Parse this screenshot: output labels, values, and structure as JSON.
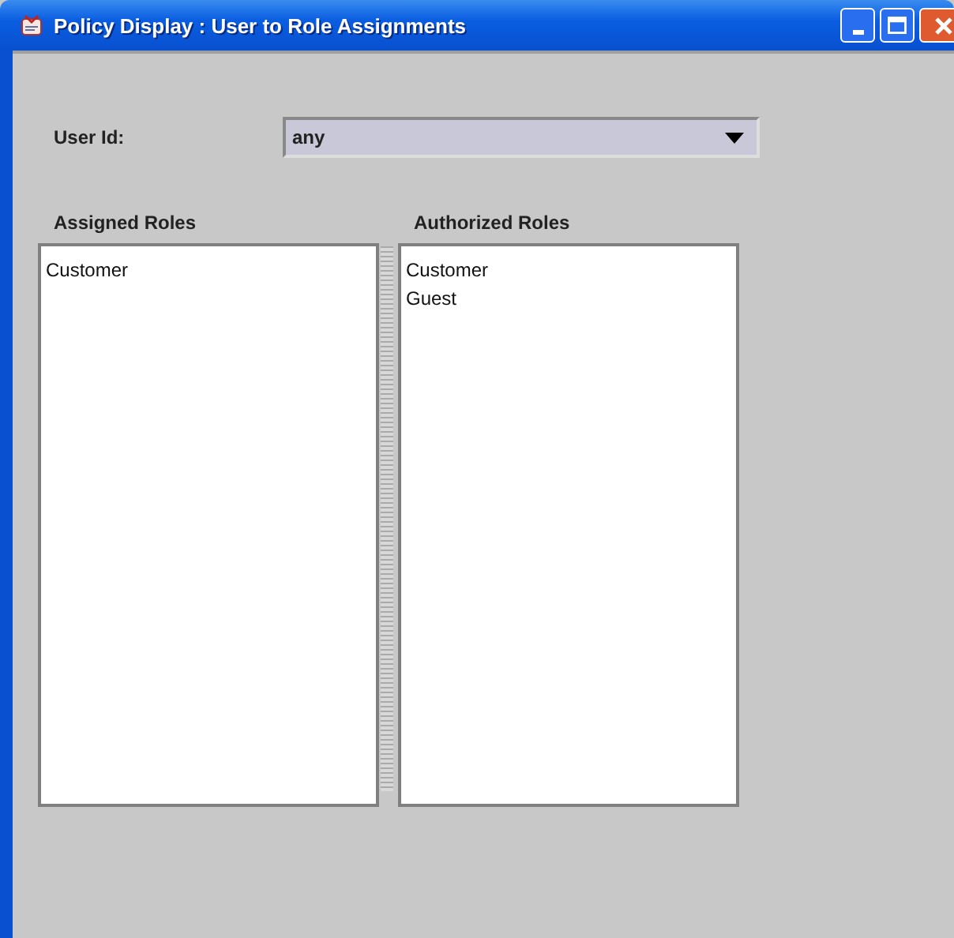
{
  "window": {
    "title": "Policy Display : User to Role Assignments"
  },
  "user_id": {
    "label": "User Id:",
    "value": "any"
  },
  "assigned_roles": {
    "label": "Assigned Roles",
    "items": [
      "Customer"
    ]
  },
  "authorized_roles": {
    "label": "Authorized Roles",
    "items": [
      "Customer",
      "Guest"
    ]
  }
}
